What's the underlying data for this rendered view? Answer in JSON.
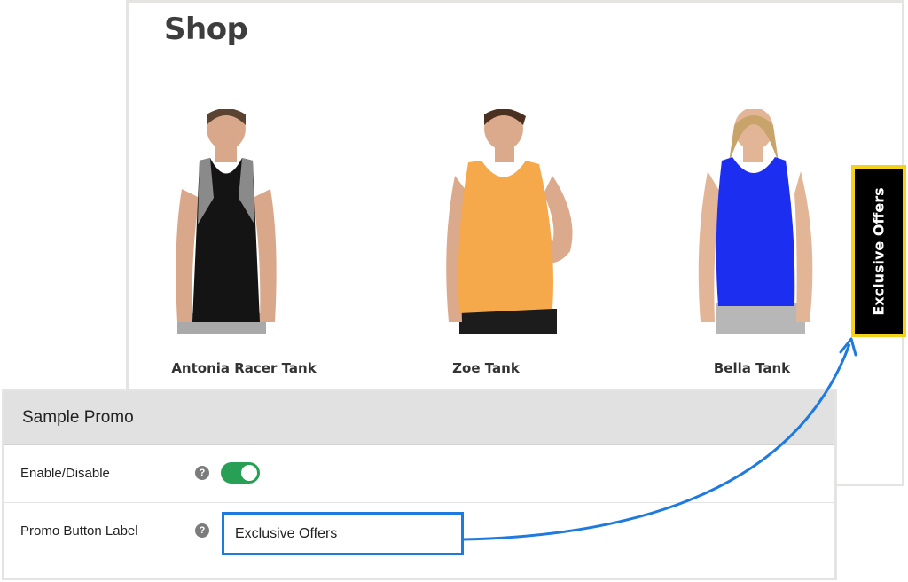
{
  "shop": {
    "title": "Shop",
    "products": [
      {
        "name": "Antonia Racer Tank",
        "top_color": "#141414",
        "trim_color": "#8a8a8a"
      },
      {
        "name": "Zoe Tank",
        "top_color": "#f5a94b",
        "trim_color": "#f5a94b"
      },
      {
        "name": "Bella Tank",
        "top_color": "#1c2ff0",
        "trim_color": "#1c2ff0"
      }
    ]
  },
  "promo_tab": {
    "label": "Exclusive Offers",
    "background": "#000000",
    "border_color": "#f3d21c"
  },
  "settings": {
    "title": "Sample Promo",
    "enable_row": {
      "label": "Enable/Disable",
      "help_icon": "question-icon",
      "enabled": true
    },
    "label_row": {
      "label": "Promo Button Label",
      "help_icon": "question-icon",
      "value": "Exclusive Offers"
    }
  },
  "colors": {
    "toggle_on": "#27a055",
    "input_highlight": "#1f7ae0",
    "arrow": "#1f7ae0"
  }
}
